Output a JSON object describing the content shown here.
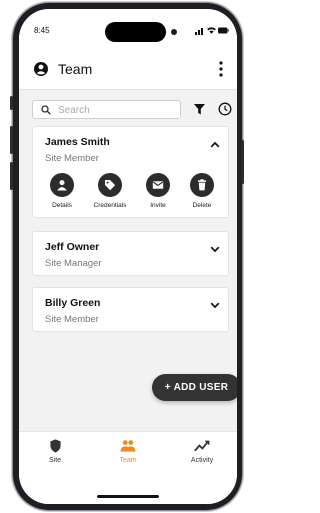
{
  "status_bar": {
    "time": "8:45"
  },
  "header": {
    "title": "Team",
    "icon": "account-circle-icon",
    "menu_icon": "more-vertical-icon"
  },
  "search": {
    "placeholder": "Search",
    "value": ""
  },
  "toolbar": {
    "filter_icon": "filter-icon",
    "history_icon": "history-icon"
  },
  "members": [
    {
      "name": "James Smith",
      "role": "Site Member",
      "expanded": true,
      "actions": [
        {
          "label": "Details",
          "icon": "person-icon"
        },
        {
          "label": "Credentials",
          "icon": "tag-icon"
        },
        {
          "label": "Invite",
          "icon": "mail-icon"
        },
        {
          "label": "Delete",
          "icon": "trash-icon"
        }
      ]
    },
    {
      "name": "Jeff Owner",
      "role": "Site Manager",
      "expanded": false
    },
    {
      "name": "Billy Green",
      "role": "Site Member",
      "expanded": false
    }
  ],
  "add_user": {
    "label": "+ ADD USER"
  },
  "bottom_nav": [
    {
      "label": "Site",
      "icon": "shield-icon",
      "active": false
    },
    {
      "label": "Team",
      "icon": "group-icon",
      "active": true
    },
    {
      "label": "Activity",
      "icon": "activity-icon",
      "active": false
    }
  ],
  "colors": {
    "accent": "#f08a24",
    "button_dark": "#333333",
    "background": "#f2f2f2"
  }
}
